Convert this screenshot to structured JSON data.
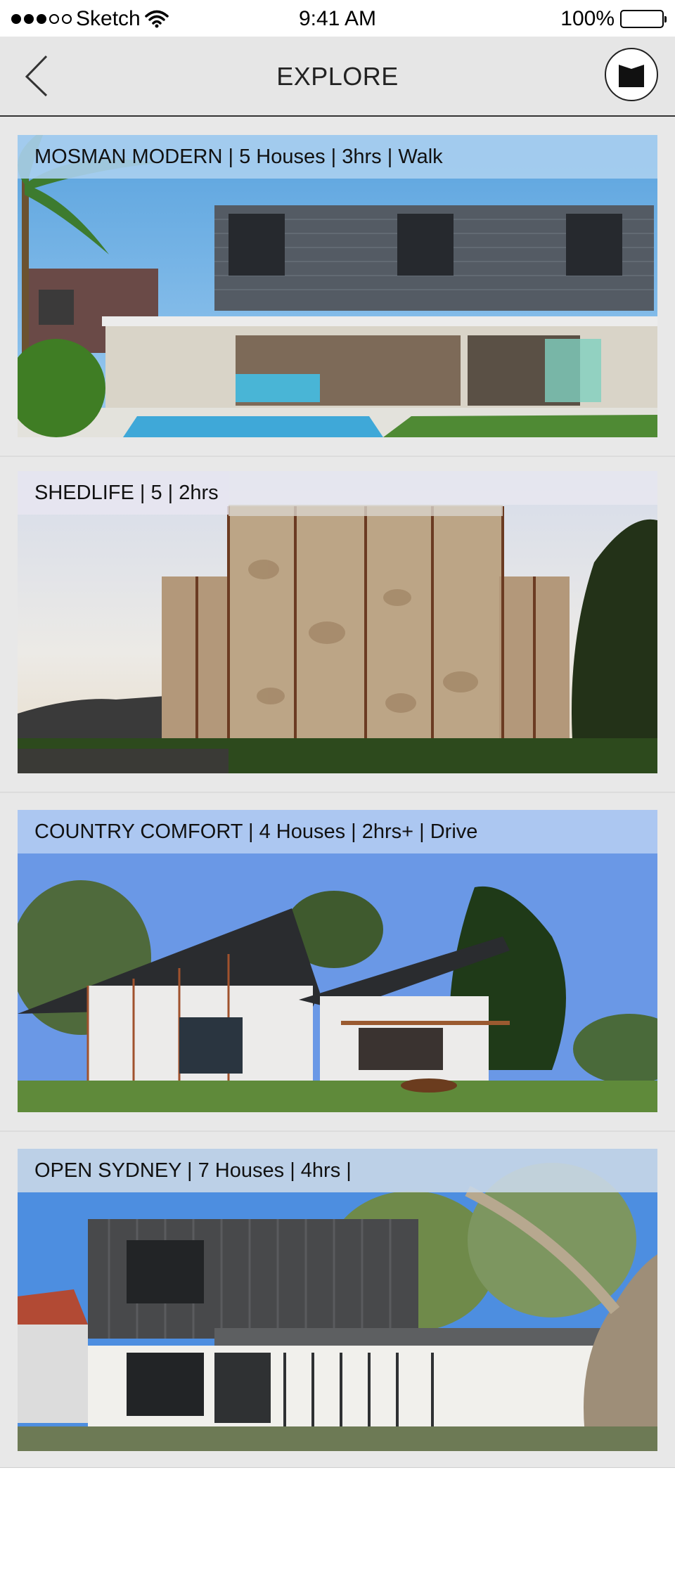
{
  "status_bar": {
    "carrier": "Sketch",
    "time": "9:41 AM",
    "battery": "100%"
  },
  "nav": {
    "title": "EXPLORE",
    "back_icon": "chevron-left-icon",
    "logo_icon": "bookmark-logo-icon"
  },
  "tours": [
    {
      "caption": "MOSMAN MODERN | 5 Houses | 3hrs | Walk"
    },
    {
      "caption": "SHEDLIFE | 5 | 2hrs"
    },
    {
      "caption": "COUNTRY COMFORT | 4 Houses | 2hrs+ | Drive"
    },
    {
      "caption": "OPEN SYDNEY | 7 Houses | 4hrs |"
    }
  ]
}
